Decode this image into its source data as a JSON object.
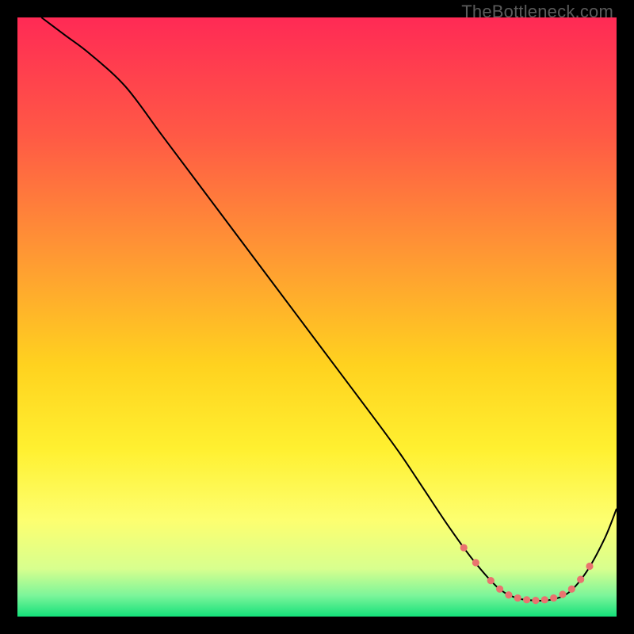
{
  "watermark": "TheBottleneck.com",
  "chart_data": {
    "type": "line",
    "title": "",
    "xlabel": "",
    "ylabel": "",
    "xlim": [
      0,
      100
    ],
    "ylim": [
      0,
      100
    ],
    "background_gradient": {
      "stops": [
        {
          "pos": 0.0,
          "color": "#ff2a55"
        },
        {
          "pos": 0.2,
          "color": "#ff5a45"
        },
        {
          "pos": 0.4,
          "color": "#ff9933"
        },
        {
          "pos": 0.58,
          "color": "#ffd21f"
        },
        {
          "pos": 0.72,
          "color": "#fff030"
        },
        {
          "pos": 0.84,
          "color": "#fdff70"
        },
        {
          "pos": 0.92,
          "color": "#d8ff8e"
        },
        {
          "pos": 0.965,
          "color": "#7cf59a"
        },
        {
          "pos": 1.0,
          "color": "#14e07a"
        }
      ]
    },
    "series": [
      {
        "name": "bottleneck-curve",
        "color": "#000000",
        "width": 2,
        "x": [
          4,
          8,
          12,
          18,
          24,
          30,
          36,
          42,
          48,
          54,
          60,
          64,
          68,
          72,
          76,
          80,
          83,
          86,
          89,
          92,
          95,
          98,
          100
        ],
        "y": [
          100,
          97,
          94,
          88.5,
          80.5,
          72.5,
          64.5,
          56.5,
          48.5,
          40.5,
          32.5,
          27,
          21,
          15,
          9.5,
          5,
          3.2,
          2.7,
          2.8,
          4,
          7.5,
          13,
          18
        ]
      }
    ],
    "highlight_points": {
      "name": "optimal-range",
      "color": "#e9736f",
      "radius": 4.6,
      "x": [
        74.5,
        76.5,
        79,
        80.5,
        82,
        83.5,
        85,
        86.5,
        88,
        89.5,
        91,
        92.5,
        94,
        95.5
      ],
      "y": [
        11.5,
        9,
        6,
        4.6,
        3.6,
        3.1,
        2.8,
        2.7,
        2.8,
        3.1,
        3.7,
        4.6,
        6.2,
        8.4
      ]
    }
  }
}
